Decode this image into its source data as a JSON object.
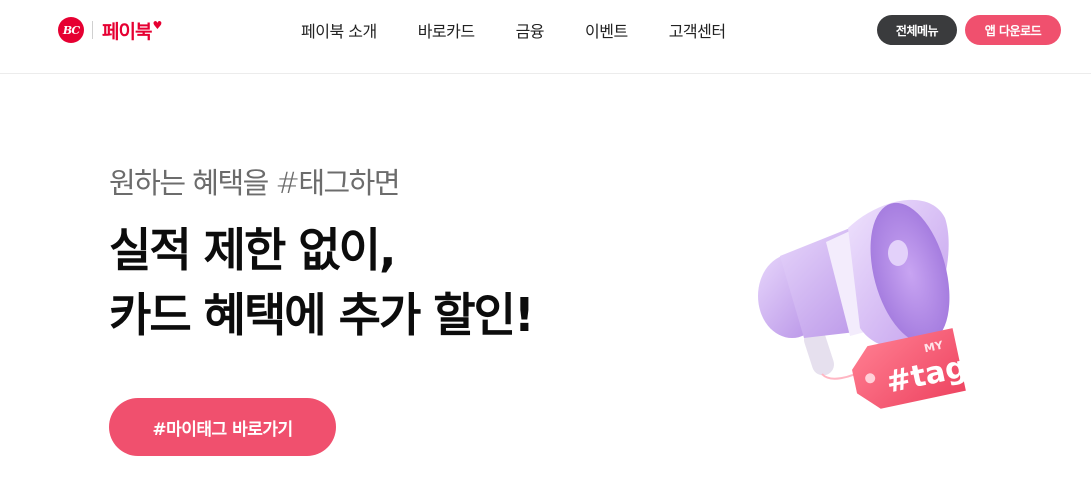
{
  "header": {
    "logo": {
      "badge": "BC",
      "text": "페이북"
    },
    "nav": [
      {
        "label": "페이북 소개"
      },
      {
        "label": "바로카드"
      },
      {
        "label": "금융"
      },
      {
        "label": "이벤트"
      },
      {
        "label": "고객센터"
      }
    ],
    "menu_button": "전체메뉴",
    "app_button": "앱 다운로드"
  },
  "hero": {
    "subtitle": "원하는 혜택을 #태그하면",
    "headline_line1": "실적 제한 없이,",
    "headline_line2": "카드 혜택에 추가 할인!",
    "cta": "#마이태그 바로가기",
    "tag_small": "MY",
    "tag_big": "#tag"
  },
  "colors": {
    "brand_red": "#e60032",
    "accent_pink": "#f0506e",
    "dark_button": "#3a3b3d",
    "megaphone_purple": "#c9a7f0"
  }
}
